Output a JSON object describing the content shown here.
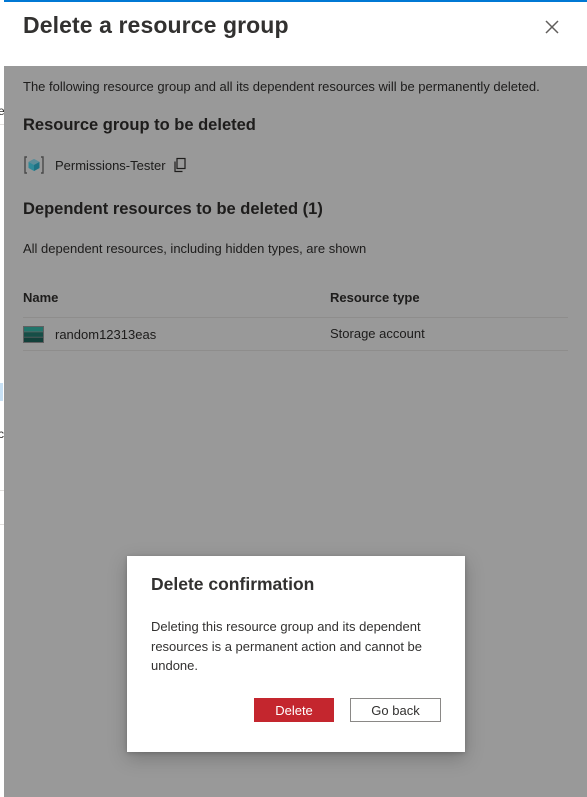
{
  "background_page": {
    "edge_chars": [
      "e",
      "c"
    ]
  },
  "panel": {
    "title": "Delete a resource group",
    "close_icon": "close-icon",
    "intro": "The following resource group and all its dependent resources will be permanently deleted.",
    "resource_group_section_title": "Resource group to be deleted",
    "resource_group": {
      "name": "Permissions-Tester",
      "icon": "resource-group-icon",
      "copy_icon": "copy-icon"
    },
    "dependent_section_title": "Dependent resources to be deleted (1)",
    "dependent_note": "All dependent resources, including hidden types, are shown",
    "table": {
      "columns": [
        "Name",
        "Resource type"
      ],
      "rows": [
        {
          "name": "random12313eas",
          "type": "Storage account",
          "icon": "storage-account-icon"
        }
      ]
    }
  },
  "dialog": {
    "title": "Delete confirmation",
    "message": "Deleting this resource group and its dependent resources is a permanent action and cannot be undone.",
    "delete_label": "Delete",
    "go_back_label": "Go back"
  },
  "colors": {
    "accent": "#0078d4",
    "danger": "#c4262e",
    "text": "#323130"
  }
}
